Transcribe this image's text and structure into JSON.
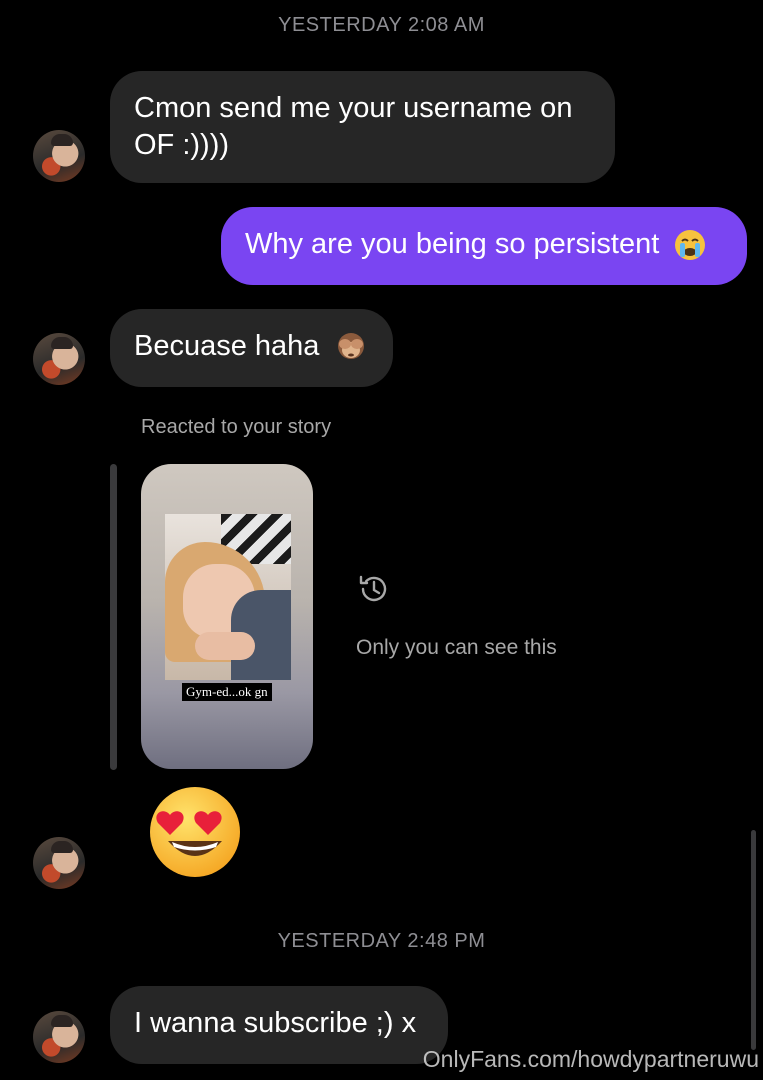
{
  "messages": {
    "timestamp_1": "YESTERDAY 2:08 AM",
    "msg_1": "Cmon send me your username on OF :))))",
    "msg_1_line1": "Cmon send me your username on",
    "msg_1_line2": "OF :))))",
    "msg_2": "Why are you being so persistent",
    "msg_2_emoji": "loudly-crying-face-emoji",
    "msg_3": "Becuase haha",
    "msg_3_emoji": "see-no-evil-monkey-emoji",
    "story_reaction_label": "Reacted to your story",
    "story_caption": "Gym-ed...ok gn",
    "story_visibility_note": "Only you can see this",
    "reaction_emoji": "heart-eyes-emoji",
    "timestamp_2": "YESTERDAY 2:48 PM",
    "msg_4": "I wanna subscribe ;) x"
  },
  "watermark": "OnlyFans.com/howdypartneruwu",
  "colors": {
    "background": "#000000",
    "incoming_bubble": "#262626",
    "outgoing_bubble": "#7a45f2",
    "muted_text": "#a8a8a8"
  }
}
